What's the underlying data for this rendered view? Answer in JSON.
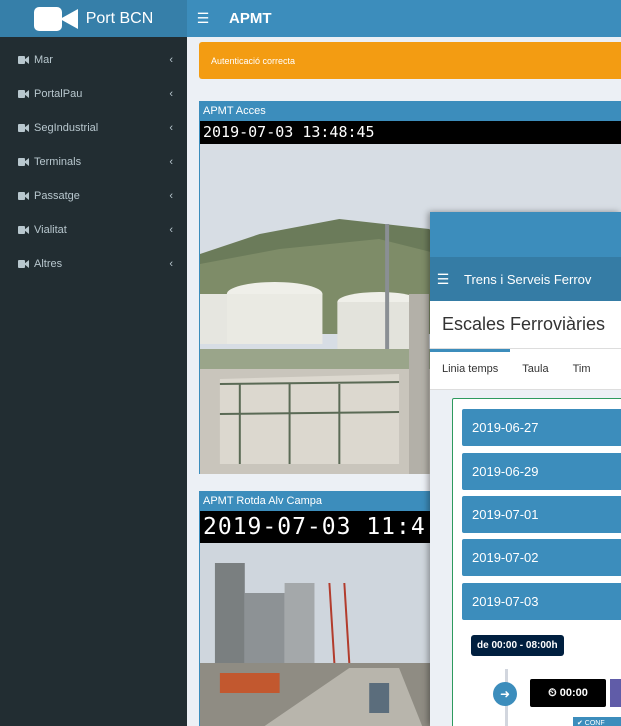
{
  "brand": {
    "title": "Port BCN",
    "logo_icon": "video-camera-icon"
  },
  "sidebar": {
    "items": [
      {
        "label": "Mar",
        "icon": "video-camera-icon"
      },
      {
        "label": "PortalPau",
        "icon": "video-camera-icon"
      },
      {
        "label": "SegIndustrial",
        "icon": "video-camera-icon"
      },
      {
        "label": "Terminals",
        "icon": "video-camera-icon"
      },
      {
        "label": "Passatge",
        "icon": "video-camera-icon"
      },
      {
        "label": "Vialitat",
        "icon": "video-camera-icon"
      },
      {
        "label": "Altres",
        "icon": "video-camera-icon"
      }
    ],
    "chevron": "‹"
  },
  "header": {
    "title": "APMT",
    "menu_icon": "hamburger-icon"
  },
  "alert": {
    "text": "Autenticació correcta",
    "color": "#f39c12"
  },
  "cameras": [
    {
      "title": "APMT Acces",
      "timestamp": "2019-07-03 13:48:45"
    },
    {
      "title": "APMT Rotda Alv Campa",
      "timestamp": "2019-07-03 11:4"
    }
  ],
  "overlay": {
    "app_title": "Trens i Serveis Ferrov",
    "page_title": "Escales Ferroviàries",
    "tabs": [
      "Linia temps",
      "Taula",
      "Tim"
    ],
    "dates": [
      "2019-06-27",
      "2019-06-29",
      "2019-07-01",
      "2019-07-02",
      "2019-07-03"
    ],
    "range_label": "de 00:00 - 08:00h",
    "time": "⏲ 00:00",
    "confirm": "✔ CONF",
    "accent": "#3c8dbc"
  }
}
